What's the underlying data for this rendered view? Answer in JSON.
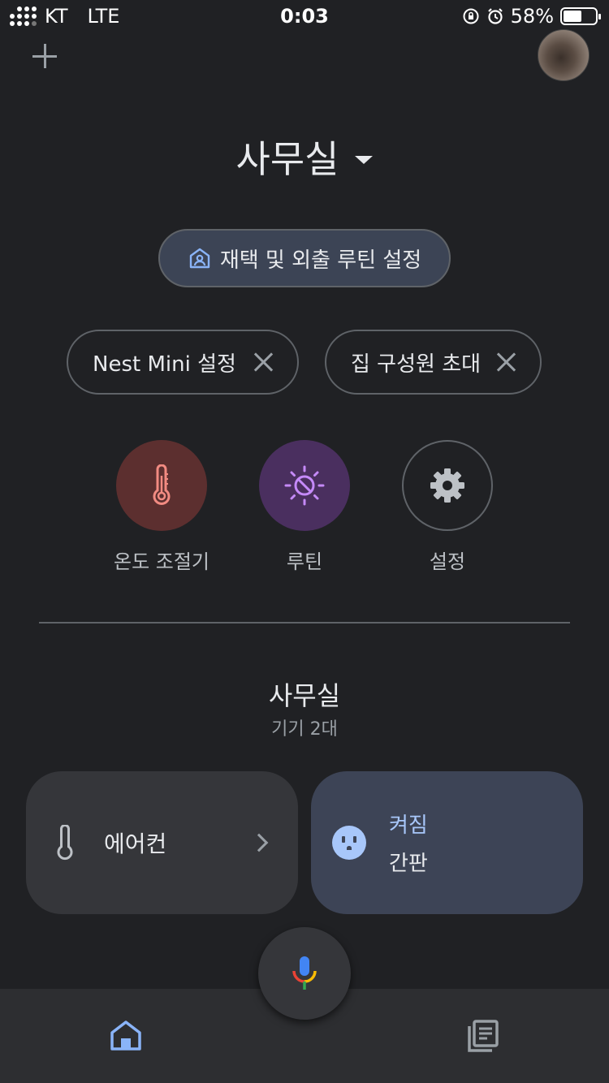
{
  "status_bar": {
    "carrier": "KT",
    "network": "LTE",
    "time": "0:03",
    "battery_text": "58%",
    "battery_level": 0.58
  },
  "header": {
    "add_icon": "plus-icon",
    "home_name": "사무실"
  },
  "routine_button": {
    "label": "재택 및 외출 루틴 설정",
    "icon": "home-away-icon"
  },
  "chips": [
    {
      "label": "Nest Mini 설정"
    },
    {
      "label": "집 구성원 초대"
    }
  ],
  "shortcuts": [
    {
      "label": "온도 조절기",
      "icon": "thermometer-icon",
      "color": "#f28b82"
    },
    {
      "label": "루틴",
      "icon": "routine-sun-icon",
      "color": "#c58af9"
    },
    {
      "label": "설정",
      "icon": "gear-icon",
      "color": "#bdc1c6"
    }
  ],
  "room": {
    "name": "사무실",
    "device_count": "기기 2대"
  },
  "devices": [
    {
      "name": "에어컨",
      "icon": "thermometer-icon"
    },
    {
      "state": "켜짐",
      "name": "간판",
      "icon": "outlet-icon"
    }
  ],
  "bottom_nav": {
    "home_icon": "home-icon",
    "feed_icon": "feed-icon",
    "mic_icon": "microphone-icon",
    "accent": "#8ab4f8"
  }
}
